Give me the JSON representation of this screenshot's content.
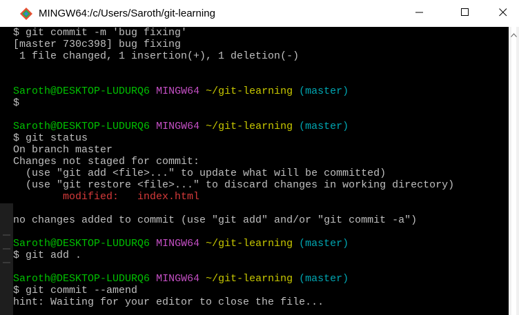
{
  "window": {
    "title": "MINGW64:/c/Users/Saroth/git-learning",
    "icon": "git-bash-diamond-icon"
  },
  "colors": {
    "user_host": "#00c200",
    "shell": "#c44fc4",
    "path": "#c8c800",
    "branch": "#00a6b2",
    "modified": "#d63a3a",
    "text": "#bfbfbf"
  },
  "terminal": {
    "lines": [
      {
        "type": "text",
        "text": "$ git commit -m 'bug fixing'"
      },
      {
        "type": "text",
        "text": "[master 730c398] bug fixing"
      },
      {
        "type": "text",
        "text": " 1 file changed, 1 insertion(+), 1 deletion(-)"
      },
      {
        "type": "blank"
      },
      {
        "type": "blank"
      },
      {
        "type": "prompt",
        "user_host": "Saroth@DESKTOP-LUDURQ6",
        "shell": "MINGW64",
        "path": "~/git-learning",
        "branch": "(master)"
      },
      {
        "type": "text",
        "text": "$"
      },
      {
        "type": "blank"
      },
      {
        "type": "prompt",
        "user_host": "Saroth@DESKTOP-LUDURQ6",
        "shell": "MINGW64",
        "path": "~/git-learning",
        "branch": "(master)"
      },
      {
        "type": "text",
        "text": "$ git status"
      },
      {
        "type": "text",
        "text": "On branch master"
      },
      {
        "type": "text",
        "text": "Changes not staged for commit:"
      },
      {
        "type": "text",
        "text": "  (use \"git add <file>...\" to update what will be committed)"
      },
      {
        "type": "text",
        "text": "  (use \"git restore <file>...\" to discard changes in working directory)"
      },
      {
        "type": "modified",
        "label": "        modified:   ",
        "file": "index.html"
      },
      {
        "type": "blank"
      },
      {
        "type": "text",
        "text": "no changes added to commit (use \"git add\" and/or \"git commit -a\")"
      },
      {
        "type": "blank"
      },
      {
        "type": "prompt",
        "user_host": "Saroth@DESKTOP-LUDURQ6",
        "shell": "MINGW64",
        "path": "~/git-learning",
        "branch": "(master)"
      },
      {
        "type": "text",
        "text": "$ git add ."
      },
      {
        "type": "blank"
      },
      {
        "type": "prompt",
        "user_host": "Saroth@DESKTOP-LUDURQ6",
        "shell": "MINGW64",
        "path": "~/git-learning",
        "branch": "(master)"
      },
      {
        "type": "text",
        "text": "$ git commit --amend"
      },
      {
        "type": "text",
        "text": "hint: Waiting for your editor to close the file..."
      }
    ]
  }
}
